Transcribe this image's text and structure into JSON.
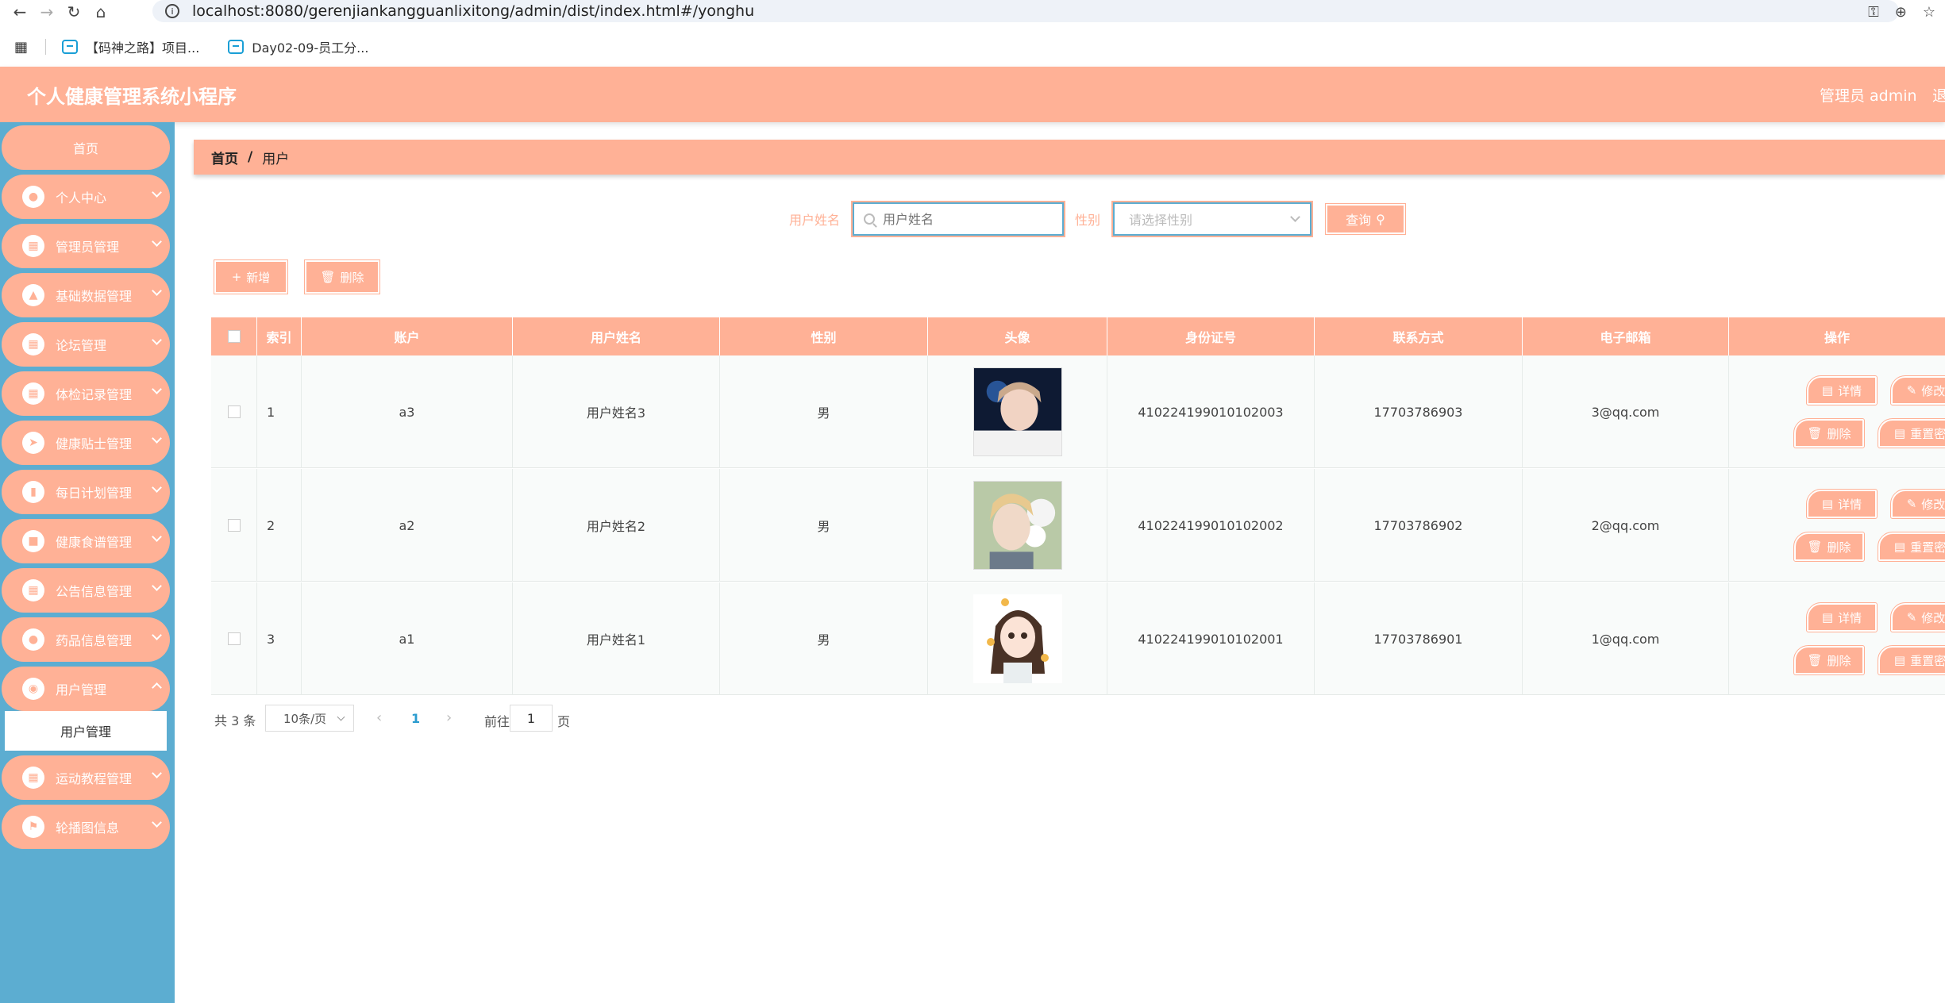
{
  "browser": {
    "url": "localhost:8080/gerenjiankangguanlixitong/admin/dist/index.html#/yonghu",
    "bookmarks": [
      "【码神之路】项目...",
      "Day02-09-员工分..."
    ]
  },
  "header": {
    "title": "个人健康管理系统小程序",
    "user": "管理员 admin",
    "logout": "退"
  },
  "sidebar": {
    "home": "首页",
    "items": [
      {
        "label": "个人中心",
        "icon": "user-icon"
      },
      {
        "label": "管理员管理",
        "icon": "grid-icon"
      },
      {
        "label": "基础数据管理",
        "icon": "pin-icon"
      },
      {
        "label": "论坛管理",
        "icon": "grid-icon"
      },
      {
        "label": "体检记录管理",
        "icon": "grid-icon"
      },
      {
        "label": "健康贴士管理",
        "icon": "send-icon"
      },
      {
        "label": "每日计划管理",
        "icon": "chart-icon"
      },
      {
        "label": "健康食谱管理",
        "icon": "monitor-icon"
      },
      {
        "label": "公告信息管理",
        "icon": "grid-icon"
      },
      {
        "label": "药品信息管理",
        "icon": "user-icon"
      },
      {
        "label": "用户管理",
        "icon": "location-icon"
      },
      {
        "label": "运动教程管理",
        "icon": "grid-icon"
      },
      {
        "label": "轮播图信息",
        "icon": "flag-icon"
      }
    ],
    "active_sub": "用户管理"
  },
  "breadcrumb": {
    "home": "首页",
    "sep": "/",
    "current": "用户"
  },
  "search": {
    "name_label": "用户姓名",
    "name_placeholder": "用户姓名",
    "gender_label": "性别",
    "gender_placeholder": "请选择性别",
    "query_label": "查询"
  },
  "toolbar": {
    "add_label": "新增",
    "delete_label": "删除"
  },
  "table": {
    "columns": [
      "索引",
      "账户",
      "用户姓名",
      "性别",
      "头像",
      "身份证号",
      "联系方式",
      "电子邮箱",
      "操作"
    ],
    "rows": [
      {
        "index": "1",
        "account": "a3",
        "name": "用户姓名3",
        "gender": "男",
        "id_card": "410224199010102003",
        "phone": "17703786903",
        "email": "3@qq.com"
      },
      {
        "index": "2",
        "account": "a2",
        "name": "用户姓名2",
        "gender": "男",
        "id_card": "410224199010102002",
        "phone": "17703786902",
        "email": "2@qq.com"
      },
      {
        "index": "3",
        "account": "a1",
        "name": "用户姓名1",
        "gender": "男",
        "id_card": "410224199010102001",
        "phone": "17703786901",
        "email": "1@qq.com"
      }
    ],
    "actions": {
      "detail": "详情",
      "edit": "修改",
      "delete": "删除",
      "reset": "重置密码"
    }
  },
  "pagination": {
    "total": "共 3 条",
    "page_size": "10条/页",
    "current_page": "1",
    "goto_label": "前往",
    "goto_value": "1",
    "goto_suffix": "页"
  },
  "colors": {
    "accent": "#ffb196",
    "sidebar": "#5cadd1",
    "link": "#2b9ccf"
  }
}
